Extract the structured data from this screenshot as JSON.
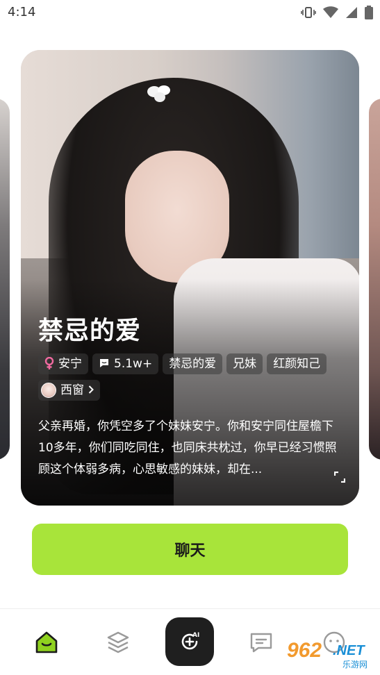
{
  "status_bar": {
    "time": "4:14",
    "icons": [
      "vibrate-icon",
      "wifi-icon",
      "signal-icon",
      "battery-icon"
    ]
  },
  "card": {
    "title": "禁忌的爱",
    "tags": [
      {
        "icon": "female-icon",
        "label": "安宁"
      },
      {
        "icon": "chat-count-icon",
        "label": "5.1w+"
      },
      {
        "icon": "",
        "label": "禁忌的爱"
      },
      {
        "icon": "",
        "label": "兄妹"
      },
      {
        "icon": "",
        "label": "红颜知己"
      }
    ],
    "author": {
      "name": "西窗"
    },
    "description": "父亲再婚，你凭空多了个妹妹安宁。你和安宁同住屋檐下10多年，你们同吃同住，也同床共枕过，你早已经习惯照顾这个体弱多病，心思敏感的妹妹，却在..."
  },
  "chat_button": {
    "label": "聊天"
  },
  "bottom_nav": {
    "items": [
      "home-icon",
      "layers-icon",
      "ai-create-icon",
      "messages-icon",
      "profile-icon"
    ],
    "center_badge": "AI"
  },
  "watermark": {
    "number": "962",
    "domain": ".NET",
    "sub": "乐游网"
  },
  "colors": {
    "accent": "#a8e43a",
    "home_active": "#8fd11f",
    "nav_center_bg": "#1f1f1f"
  }
}
